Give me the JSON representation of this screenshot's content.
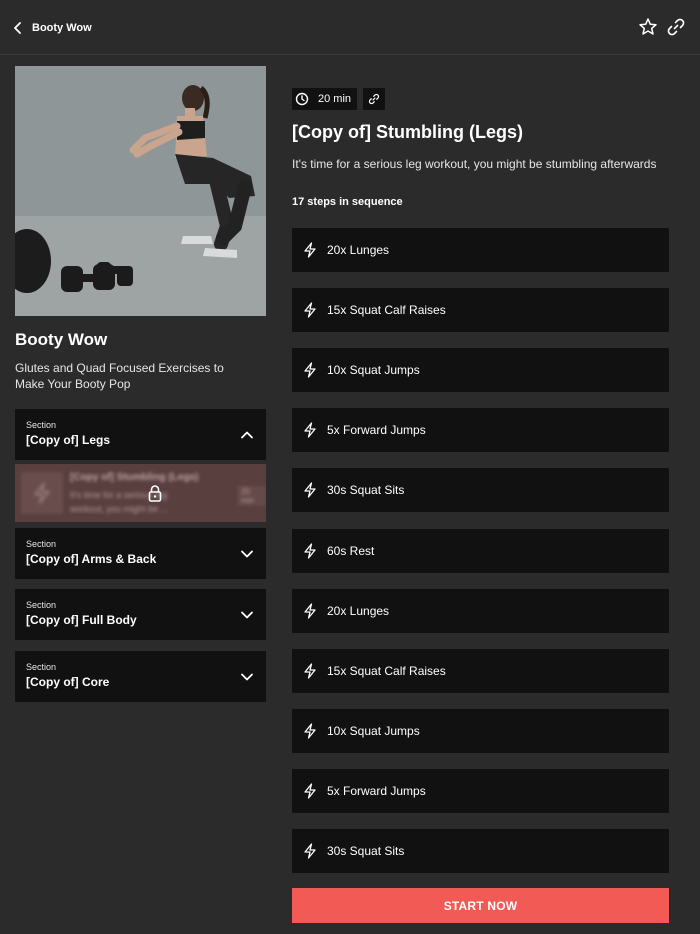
{
  "header": {
    "back_label": "Booty Wow",
    "icons": {
      "back": "chevron-left-icon",
      "favorite": "star-outline-icon",
      "share": "link-icon"
    }
  },
  "program": {
    "title": "Booty Wow",
    "description": "Glutes and Quad Focused Exercises to Make Your Booty Pop",
    "hero_image": "woman-squatting-with-dumbbells-photo"
  },
  "sections": [
    {
      "kicker": "Section",
      "name": "[Copy of] Legs",
      "expanded": true
    },
    {
      "kicker": "Section",
      "name": "[Copy of] Arms & Back",
      "expanded": false
    },
    {
      "kicker": "Section",
      "name": "[Copy of] Full Body",
      "expanded": false
    },
    {
      "kicker": "Section",
      "name": "[Copy of] Core",
      "expanded": false
    }
  ],
  "locked_workout": {
    "title": "[Copy of] Stumbling (Legs)",
    "description": "It's time for a serious leg workout, you might be ...",
    "duration": "20 min",
    "icon": "lock-icon"
  },
  "workout": {
    "duration": "20 min",
    "title": "[Copy of] Stumbling (Legs)",
    "description": "It's time for a serious leg workout, you might be stumbling afterwards",
    "steps_count": "17 steps in sequence",
    "steps": [
      "20x Lunges",
      "15x Squat Calf Raises",
      "10x Squat Jumps",
      "5x Forward Jumps",
      "30s Squat Sits",
      "60s Rest",
      "20x Lunges",
      "15x Squat Calf Raises",
      "10x Squat Jumps",
      "5x Forward Jumps",
      "30s Squat Sits"
    ],
    "start_label": "START NOW"
  },
  "colors": {
    "background": "#2b2b2b",
    "card": "#111111",
    "accent": "#f15a55",
    "locked_card": "#5a3f3f"
  }
}
